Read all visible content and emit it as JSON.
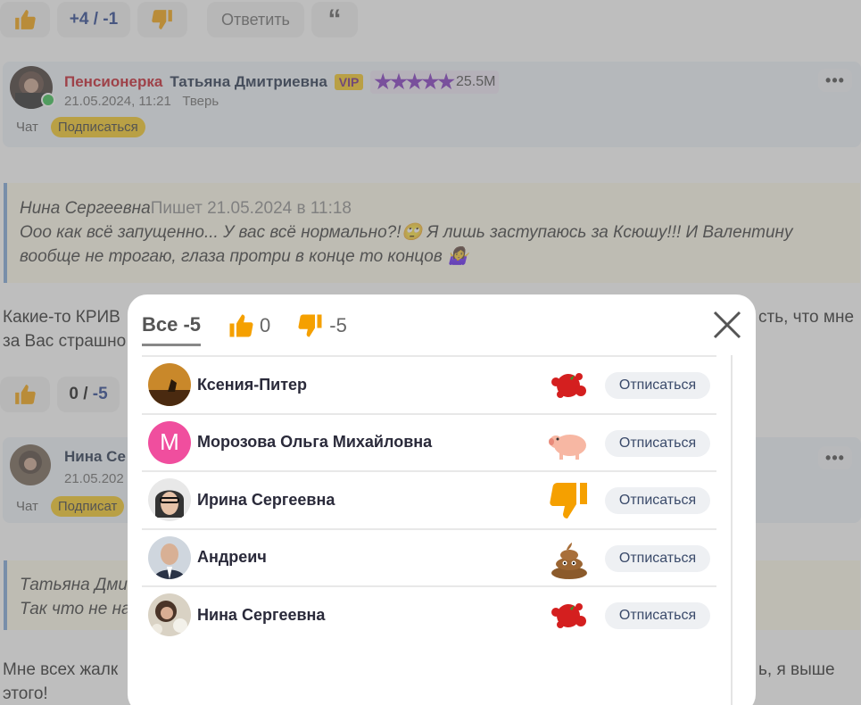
{
  "top_votes": {
    "score_up": "+4",
    "separator": "/",
    "score_down": "-1",
    "reply_label": "Ответить",
    "quote_glyph": "“"
  },
  "comment1": {
    "role": "Пенсионерка",
    "name": "Татьяна Дмитриевна",
    "vip": "VIP",
    "stars": "★★★★★",
    "rating": "25.5M",
    "date": "21.05.2024, 11:21",
    "city": "Тверь",
    "chat": "Чат",
    "subscribe": "Подписаться",
    "more": "•••"
  },
  "quote1": {
    "author": "Нина Сергеевна",
    "meta": "Пишет 21.05.2024 в 11:18",
    "line1": "Ооо как всё запущенно... У вас всё нормально?!🙄 Я лишь заступаюсь за Ксюшу!!! И Валентину",
    "line2": "вообще не трогаю, глаза протри в конце то концов 🤷‍♀️"
  },
  "body1": {
    "line1_left": "Какие-то КРИВ",
    "line1_right": "сть, что мне",
    "line2_left": "за Вас страшно"
  },
  "mid_votes": {
    "score_up": "0",
    "separator": "/",
    "score_down": "-5"
  },
  "comment2": {
    "name_partial": "Нина Се",
    "date_partial": "21.05.202",
    "chat": "Чат",
    "subscribe_partial": "Подписат",
    "more": "•••"
  },
  "quote2": {
    "line1_partial": "Татьяна Дми",
    "line2_partial": "Так что не на"
  },
  "body2": {
    "line1_left": "Мне всех жалк",
    "line1_right": "ь, я выше",
    "line2": "этого!"
  },
  "modal": {
    "tabs": [
      {
        "label": "Все -5"
      },
      {
        "label": "0",
        "icon": "thumbs-up-icon"
      },
      {
        "label": "-5",
        "icon": "thumbs-down-icon"
      }
    ],
    "unsubscribe_label": "Отписаться",
    "users": [
      {
        "name": "Ксения-Питер",
        "reaction": "tomato-splat-icon"
      },
      {
        "name": "Морозова Ольга Михайловна",
        "avatar_letter": "М",
        "reaction": "pig-icon"
      },
      {
        "name": "Ирина Сергеевна",
        "reaction": "thumbs-down-icon"
      },
      {
        "name": "Андреич",
        "reaction": "poop-icon"
      },
      {
        "name": "Нина Сергеевна",
        "reaction": "tomato-splat-icon"
      }
    ]
  },
  "colors": {
    "accent_orange": "#f5a000",
    "vip_yellow": "#f5c518",
    "role_red": "#c1121f",
    "star_purple": "#7b2cbf"
  }
}
